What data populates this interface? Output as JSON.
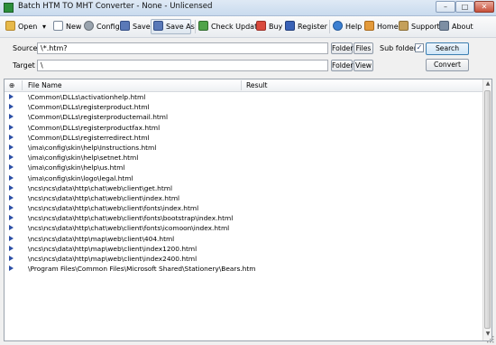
{
  "window": {
    "title": "Batch HTM TO MHT Converter - None - Unlicensed",
    "controls": {
      "minimize": "–",
      "maximize": "□",
      "close": "✕"
    }
  },
  "toolbar": {
    "open": "Open",
    "new": "New",
    "config": "Config",
    "save": "Save",
    "save_as": "Save As",
    "check_update": "Check Update",
    "buy": "Buy",
    "register": "Register",
    "help": "Help",
    "home": "Home",
    "support": "Support",
    "about": "About",
    "icons": {
      "open": "folder-open-icon",
      "new": "new-file-icon",
      "config": "gear-icon",
      "save": "floppy-icon",
      "save_as": "floppy-as-icon",
      "check_update": "update-icon",
      "buy": "cart-icon",
      "register": "register-icon",
      "help": "help-icon",
      "home": "home-icon",
      "support": "support-icon",
      "about": "about-icon"
    }
  },
  "form": {
    "source_label": "Source",
    "source_value": "\\*.htm?",
    "target_label": "Target",
    "target_value": "\\",
    "folder_button": "Folder",
    "files_button": "Files",
    "view_button": "View",
    "subfolders_label": "Sub folders",
    "subfolders_checked": "✓",
    "search_button": "Search",
    "convert_button": "Convert"
  },
  "table": {
    "headers": {
      "status": "⊕",
      "file_name": "File Name",
      "result": "Result"
    },
    "rows": [
      "\\Common\\DLLs\\activationhelp.html",
      "\\Common\\DLLs\\registerproduct.html",
      "\\Common\\DLLs\\registerproductemail.html",
      "\\Common\\DLLs\\registerproductfax.html",
      "\\Common\\DLLs\\registerredirect.html",
      "\\ima\\config\\skin\\help\\Instructions.html",
      "\\ima\\config\\skin\\help\\setnet.html",
      "\\ima\\config\\skin\\help\\us.html",
      "\\ima\\config\\skin\\logo\\legal.html",
      "\\ncs\\ncs\\data\\http\\chat\\web\\client\\get.html",
      "\\ncs\\ncs\\data\\http\\chat\\web\\client\\index.html",
      "\\ncs\\ncs\\data\\http\\chat\\web\\client\\fonts\\index.html",
      "\\ncs\\ncs\\data\\http\\chat\\web\\client\\fonts\\bootstrap\\index.html",
      "\\ncs\\ncs\\data\\http\\chat\\web\\client\\fonts\\icomoon\\index.html",
      "\\ncs\\ncs\\data\\http\\map\\web\\client\\404.html",
      "\\ncs\\ncs\\data\\http\\map\\web\\client\\index1200.html",
      "\\ncs\\ncs\\data\\http\\map\\web\\client\\index2400.html",
      "\\Program Files\\Common Files\\Microsoft Shared\\Stationery\\Bears.htm"
    ]
  },
  "colors": {
    "accent": "#3c7fb1",
    "row_arrow": "#2c4fa6",
    "close_button": "#c7503a"
  }
}
